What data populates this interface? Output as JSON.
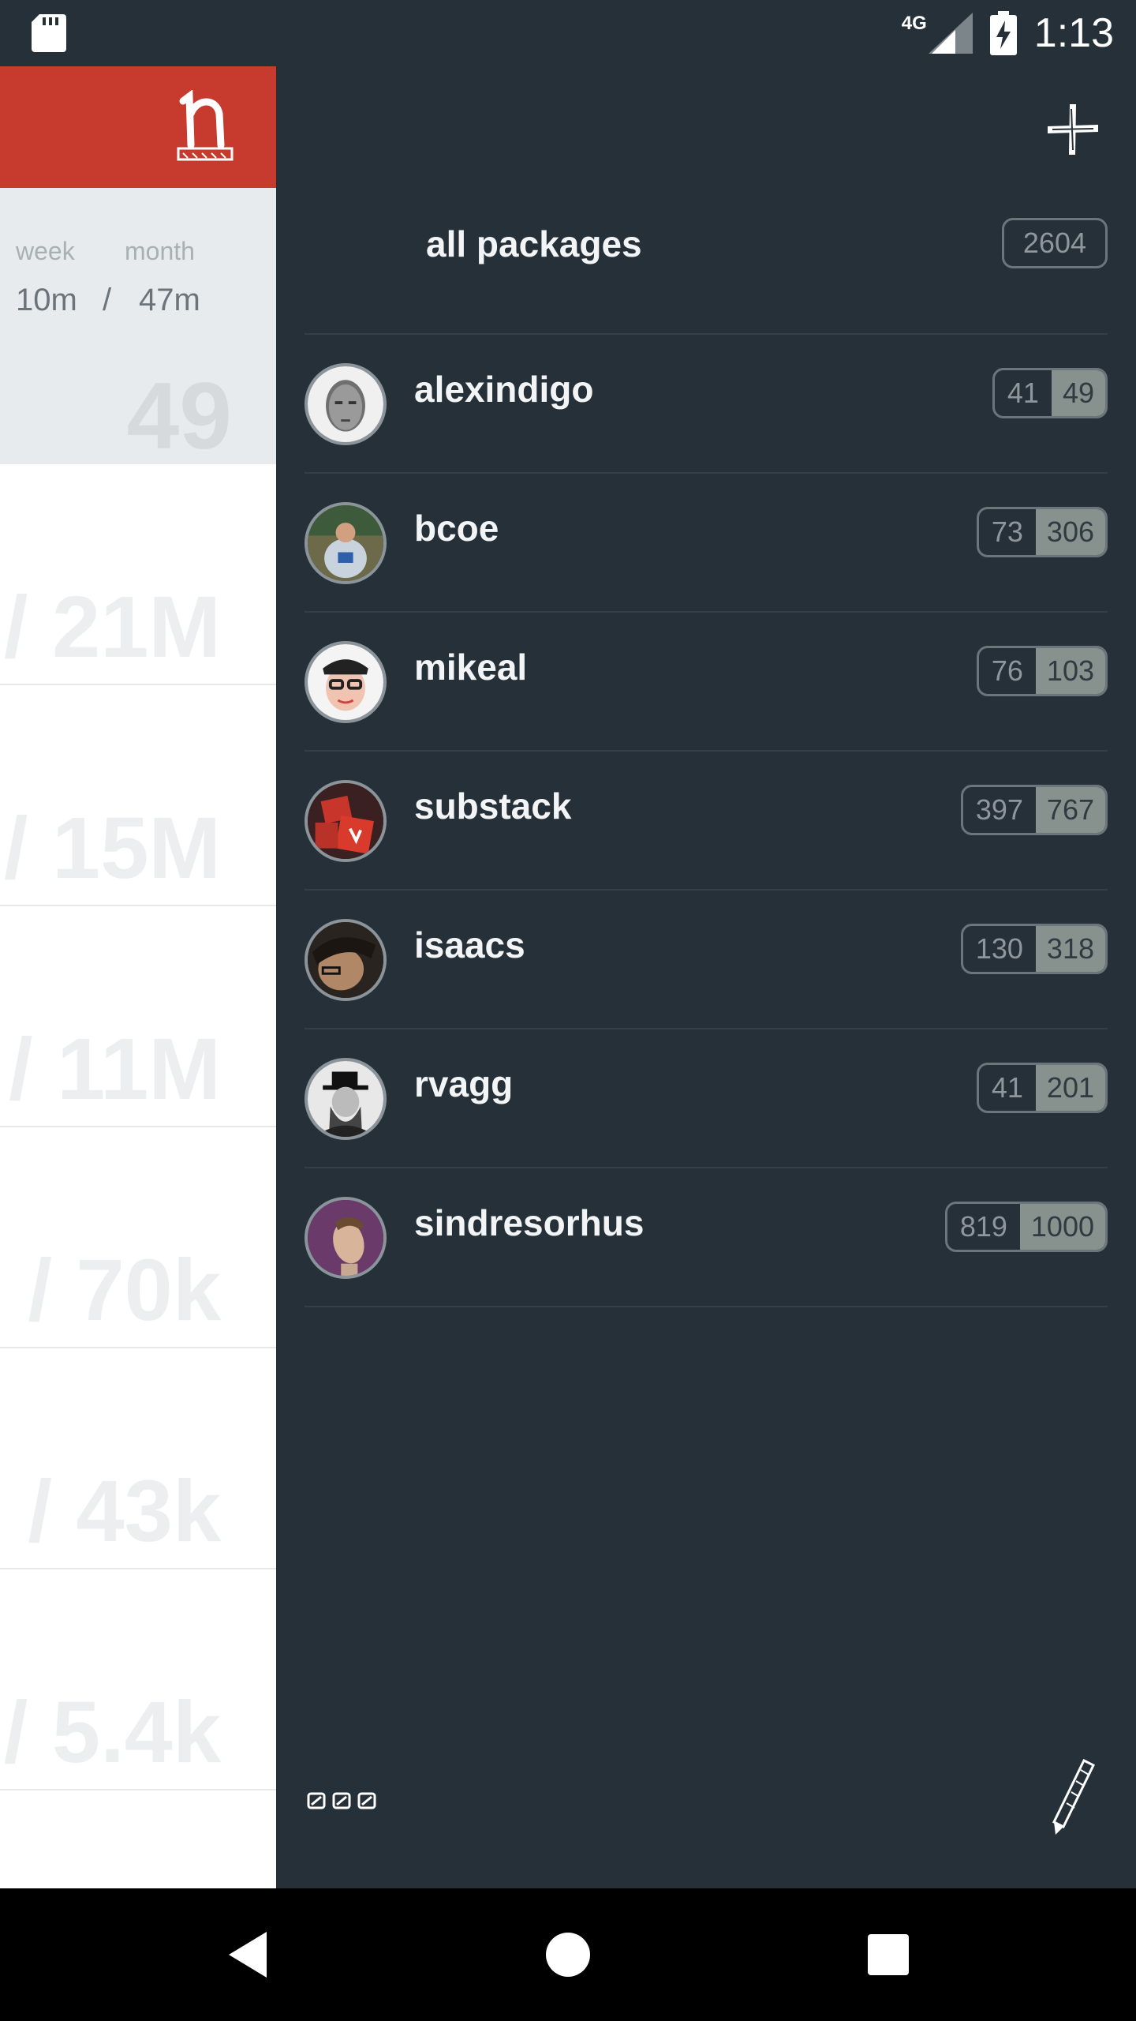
{
  "status_bar": {
    "network_type": "4G",
    "time": "1:13",
    "icons": [
      "sd-card-icon",
      "signal-icon",
      "battery-charging-icon"
    ]
  },
  "background_app": {
    "brand_color": "#c73a2e",
    "logo_icon": "npm-n-logo-icon",
    "stats": {
      "week_label": "week",
      "month_label": "month",
      "week_value": "10m",
      "separator": "/",
      "month_value": "47m",
      "count": "49"
    },
    "rows": [
      "/ 21M",
      "/ 15M",
      "/ 11M",
      "/ 70k",
      "/ 43k",
      "/ 5.4k"
    ]
  },
  "drawer": {
    "add_icon": "plus-icon",
    "all_packages": {
      "label": "all packages",
      "count": "2604"
    },
    "users": [
      {
        "name": "alexindigo",
        "a": "41",
        "b": "49",
        "avatar_icon": "avatar-alexindigo"
      },
      {
        "name": "bcoe",
        "a": "73",
        "b": "306",
        "avatar_icon": "avatar-bcoe"
      },
      {
        "name": "mikeal",
        "a": "76",
        "b": "103",
        "avatar_icon": "avatar-mikeal"
      },
      {
        "name": "substack",
        "a": "397",
        "b": "767",
        "avatar_icon": "avatar-substack"
      },
      {
        "name": "isaacs",
        "a": "130",
        "b": "318",
        "avatar_icon": "avatar-isaacs"
      },
      {
        "name": "rvagg",
        "a": "41",
        "b": "201",
        "avatar_icon": "avatar-rvagg"
      },
      {
        "name": "sindresorhus",
        "a": "819",
        "b": "1000",
        "avatar_icon": "avatar-sindresorhus"
      }
    ],
    "footer_logo_icon": "npm-logo-icon",
    "edit_icon": "pen-icon"
  },
  "nav_bar": {
    "icons": [
      "back-icon",
      "home-icon",
      "recents-icon"
    ]
  }
}
